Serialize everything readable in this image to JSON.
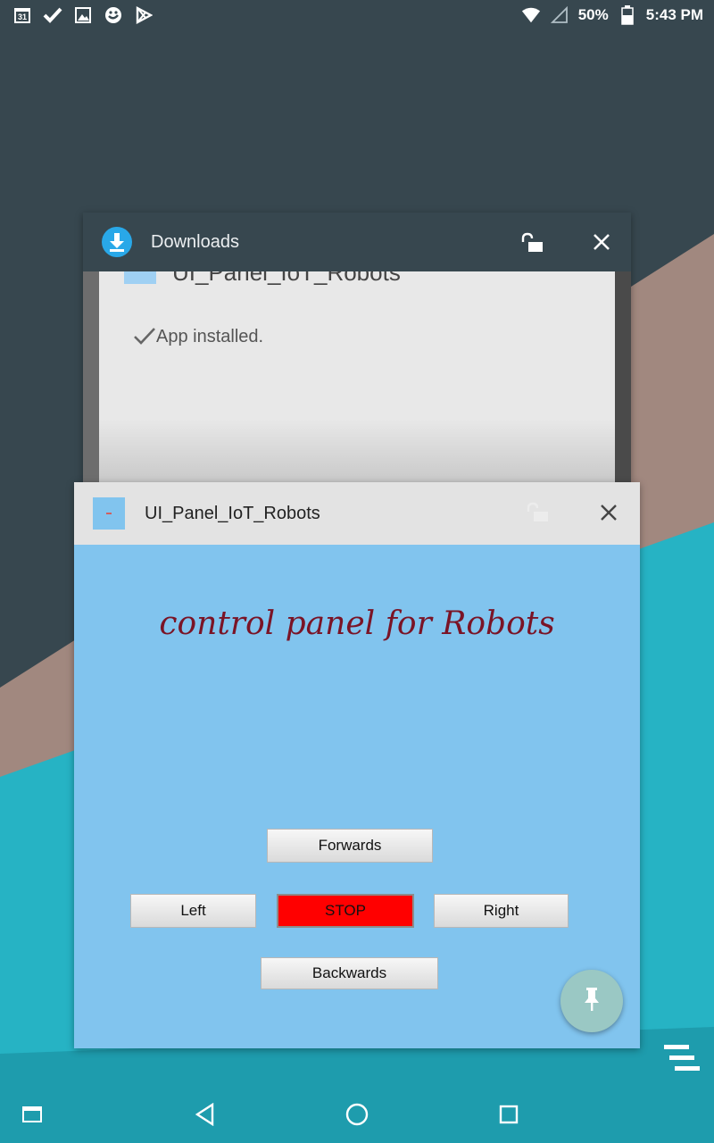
{
  "status_bar": {
    "battery_percent": "50%",
    "time": "5:43 PM",
    "notification_icons": [
      "calendar-31-icon",
      "check-icon",
      "image-icon",
      "sync-icon",
      "play-store-icon"
    ],
    "calendar_day": "31"
  },
  "recents": {
    "downloads_card": {
      "title": "Downloads",
      "partial_row_label": "UI_Panel_IoT_Robots",
      "status_text": "App installed."
    },
    "app_card": {
      "title": "UI_Panel_IoT_Robots",
      "heading": "control panel for Robots",
      "buttons": {
        "forwards": "Forwards",
        "left": "Left",
        "stop": "STOP",
        "right": "Right",
        "backwards": "Backwards"
      }
    }
  },
  "colors": {
    "downloads_header": "#37474f",
    "app_background": "#81c4ee",
    "heading_color": "#7a1426",
    "stop_button": "#ff0000"
  }
}
